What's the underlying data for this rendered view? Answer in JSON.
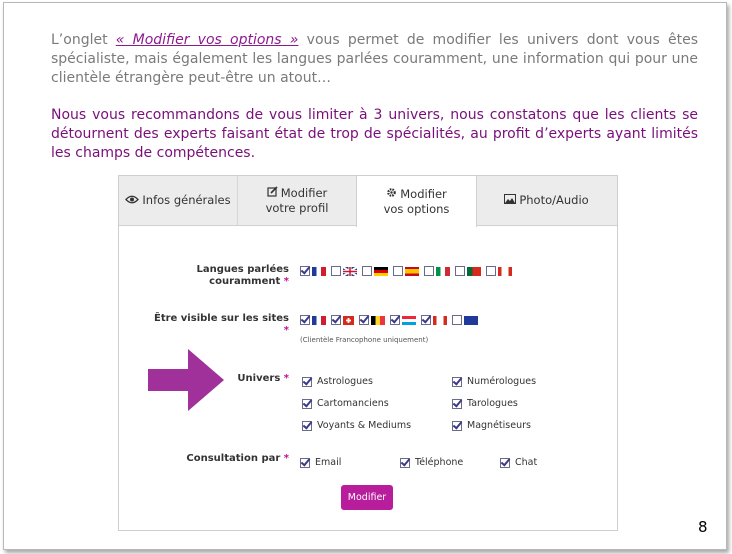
{
  "intro": {
    "pre": "L’onglet ",
    "link": "« Modifier vos options »",
    "post": " vous permet de modifier les univers dont vous êtes spécialiste, mais également les langues parlées couramment, une information qui pour une clientèle étrangère peut-être un atout…"
  },
  "recommendation": "Nous vous recommandons de vous limiter à 3 univers, nous constatons que les clients se détournent des experts faisant état de trop de spécialités, au profit d’experts ayant limités les champs de compétences.",
  "tabs": [
    {
      "label": "Infos générales",
      "icon": "eye-icon"
    },
    {
      "label1": "Modifier",
      "label2": "votre profil",
      "icon": "edit-icon"
    },
    {
      "label1": "Modifier",
      "label2": "vos options",
      "icon": "gear-icon"
    },
    {
      "label": "Photo/Audio",
      "icon": "image-icon"
    }
  ],
  "form": {
    "languages_label1": "Langues parlées",
    "languages_label2": "couramment",
    "required": "*",
    "sites_label": "Être visible sur les sites",
    "sites_note": "(Clientèle Francophone uniquement)",
    "univers_label": "Univers",
    "univers": [
      {
        "label": "Astrologues",
        "checked": true
      },
      {
        "label": "Numérologues",
        "checked": true
      },
      {
        "label": "Cartomanciens",
        "checked": true
      },
      {
        "label": "Tarologues",
        "checked": true
      },
      {
        "label": "Voyants & Mediums",
        "checked": true
      },
      {
        "label": "Magnétiseurs",
        "checked": true
      }
    ],
    "consultation_label": "Consultation par",
    "consultation": [
      {
        "label": "Email",
        "checked": true
      },
      {
        "label": "Téléphone",
        "checked": true
      },
      {
        "label": "Chat",
        "checked": true
      }
    ],
    "submit": "Modifier"
  },
  "colors": {
    "accent": "#b81d9c",
    "text_purple": "#7a0f7a",
    "arrow": "#a0309a"
  },
  "page_number": "8"
}
